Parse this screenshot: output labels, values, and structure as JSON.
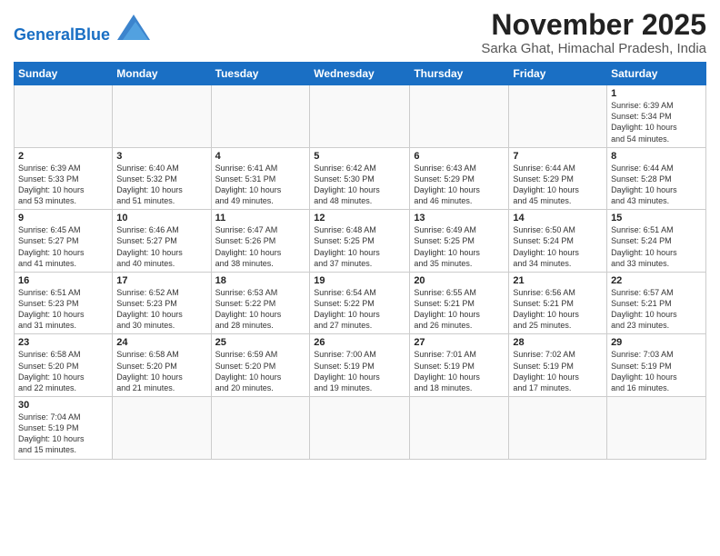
{
  "header": {
    "logo_general": "General",
    "logo_blue": "Blue",
    "month": "November 2025",
    "location": "Sarka Ghat, Himachal Pradesh, India"
  },
  "days_of_week": [
    "Sunday",
    "Monday",
    "Tuesday",
    "Wednesday",
    "Thursday",
    "Friday",
    "Saturday"
  ],
  "weeks": [
    [
      {
        "day": "",
        "content": ""
      },
      {
        "day": "",
        "content": ""
      },
      {
        "day": "",
        "content": ""
      },
      {
        "day": "",
        "content": ""
      },
      {
        "day": "",
        "content": ""
      },
      {
        "day": "",
        "content": ""
      },
      {
        "day": "1",
        "content": "Sunrise: 6:39 AM\nSunset: 5:34 PM\nDaylight: 10 hours\nand 54 minutes."
      }
    ],
    [
      {
        "day": "2",
        "content": "Sunrise: 6:39 AM\nSunset: 5:33 PM\nDaylight: 10 hours\nand 53 minutes."
      },
      {
        "day": "3",
        "content": "Sunrise: 6:40 AM\nSunset: 5:32 PM\nDaylight: 10 hours\nand 51 minutes."
      },
      {
        "day": "4",
        "content": "Sunrise: 6:41 AM\nSunset: 5:31 PM\nDaylight: 10 hours\nand 49 minutes."
      },
      {
        "day": "5",
        "content": "Sunrise: 6:42 AM\nSunset: 5:30 PM\nDaylight: 10 hours\nand 48 minutes."
      },
      {
        "day": "6",
        "content": "Sunrise: 6:43 AM\nSunset: 5:29 PM\nDaylight: 10 hours\nand 46 minutes."
      },
      {
        "day": "7",
        "content": "Sunrise: 6:44 AM\nSunset: 5:29 PM\nDaylight: 10 hours\nand 45 minutes."
      },
      {
        "day": "8",
        "content": "Sunrise: 6:44 AM\nSunset: 5:28 PM\nDaylight: 10 hours\nand 43 minutes."
      }
    ],
    [
      {
        "day": "9",
        "content": "Sunrise: 6:45 AM\nSunset: 5:27 PM\nDaylight: 10 hours\nand 41 minutes."
      },
      {
        "day": "10",
        "content": "Sunrise: 6:46 AM\nSunset: 5:27 PM\nDaylight: 10 hours\nand 40 minutes."
      },
      {
        "day": "11",
        "content": "Sunrise: 6:47 AM\nSunset: 5:26 PM\nDaylight: 10 hours\nand 38 minutes."
      },
      {
        "day": "12",
        "content": "Sunrise: 6:48 AM\nSunset: 5:25 PM\nDaylight: 10 hours\nand 37 minutes."
      },
      {
        "day": "13",
        "content": "Sunrise: 6:49 AM\nSunset: 5:25 PM\nDaylight: 10 hours\nand 35 minutes."
      },
      {
        "day": "14",
        "content": "Sunrise: 6:50 AM\nSunset: 5:24 PM\nDaylight: 10 hours\nand 34 minutes."
      },
      {
        "day": "15",
        "content": "Sunrise: 6:51 AM\nSunset: 5:24 PM\nDaylight: 10 hours\nand 33 minutes."
      }
    ],
    [
      {
        "day": "16",
        "content": "Sunrise: 6:51 AM\nSunset: 5:23 PM\nDaylight: 10 hours\nand 31 minutes."
      },
      {
        "day": "17",
        "content": "Sunrise: 6:52 AM\nSunset: 5:23 PM\nDaylight: 10 hours\nand 30 minutes."
      },
      {
        "day": "18",
        "content": "Sunrise: 6:53 AM\nSunset: 5:22 PM\nDaylight: 10 hours\nand 28 minutes."
      },
      {
        "day": "19",
        "content": "Sunrise: 6:54 AM\nSunset: 5:22 PM\nDaylight: 10 hours\nand 27 minutes."
      },
      {
        "day": "20",
        "content": "Sunrise: 6:55 AM\nSunset: 5:21 PM\nDaylight: 10 hours\nand 26 minutes."
      },
      {
        "day": "21",
        "content": "Sunrise: 6:56 AM\nSunset: 5:21 PM\nDaylight: 10 hours\nand 25 minutes."
      },
      {
        "day": "22",
        "content": "Sunrise: 6:57 AM\nSunset: 5:21 PM\nDaylight: 10 hours\nand 23 minutes."
      }
    ],
    [
      {
        "day": "23",
        "content": "Sunrise: 6:58 AM\nSunset: 5:20 PM\nDaylight: 10 hours\nand 22 minutes."
      },
      {
        "day": "24",
        "content": "Sunrise: 6:58 AM\nSunset: 5:20 PM\nDaylight: 10 hours\nand 21 minutes."
      },
      {
        "day": "25",
        "content": "Sunrise: 6:59 AM\nSunset: 5:20 PM\nDaylight: 10 hours\nand 20 minutes."
      },
      {
        "day": "26",
        "content": "Sunrise: 7:00 AM\nSunset: 5:19 PM\nDaylight: 10 hours\nand 19 minutes."
      },
      {
        "day": "27",
        "content": "Sunrise: 7:01 AM\nSunset: 5:19 PM\nDaylight: 10 hours\nand 18 minutes."
      },
      {
        "day": "28",
        "content": "Sunrise: 7:02 AM\nSunset: 5:19 PM\nDaylight: 10 hours\nand 17 minutes."
      },
      {
        "day": "29",
        "content": "Sunrise: 7:03 AM\nSunset: 5:19 PM\nDaylight: 10 hours\nand 16 minutes."
      }
    ],
    [
      {
        "day": "30",
        "content": "Sunrise: 7:04 AM\nSunset: 5:19 PM\nDaylight: 10 hours\nand 15 minutes."
      },
      {
        "day": "",
        "content": ""
      },
      {
        "day": "",
        "content": ""
      },
      {
        "day": "",
        "content": ""
      },
      {
        "day": "",
        "content": ""
      },
      {
        "day": "",
        "content": ""
      },
      {
        "day": "",
        "content": ""
      }
    ]
  ]
}
